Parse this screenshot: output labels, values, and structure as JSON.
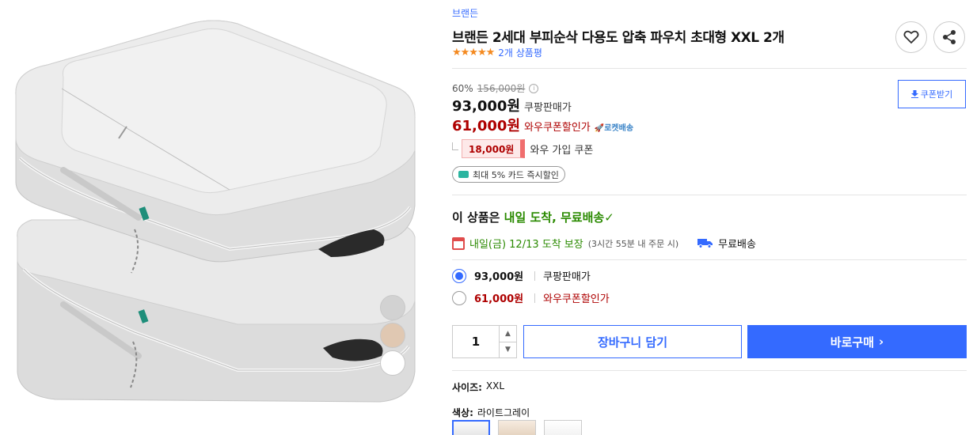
{
  "product": {
    "brand": "브랜든",
    "title": "브랜든 2세대 부피순삭 다용도 압축 파우치 초대형 XXL 2개",
    "stars": "★★★★★",
    "review_count": "2개 상품평"
  },
  "pricing": {
    "discount_rate": "60%",
    "original_price": "156,000원",
    "info_glyph": "i",
    "price": "93,000원",
    "price_label": "쿠팡판매가",
    "wow_price": "61,000원",
    "wow_label": "와우쿠폰할인가",
    "rocket_label": "🚀로켓배송",
    "coupon_button": "쿠폰받기",
    "coupon_amount": "18,000원",
    "coupon_text": "와우 가입 쿠폰",
    "card_discount": "최대 5% 카드 즉시할인"
  },
  "delivery": {
    "head_prefix": "이 상품은 ",
    "head_highlight": "내일 도착, 무료배송",
    "check": "✓",
    "date": "내일(금) 12/13 도착 보장",
    "cutoff": "(3시간 55분 내 주문 시)",
    "shipping": "무료배송"
  },
  "options": [
    {
      "price": "93,000원",
      "label": "쿠팡판매가",
      "selected": true
    },
    {
      "price": "61,000원",
      "label": "와우쿠폰할인가",
      "selected": false
    }
  ],
  "purchase": {
    "quantity": "1",
    "qty_up": "▲",
    "qty_down": "▼",
    "cart_button": "장바구니 담기",
    "buy_button": "바로구매",
    "buy_arrow": "›"
  },
  "specs": {
    "size_label": "사이즈:",
    "size_value": "XXL",
    "color_label": "색상:",
    "color_value": "라이트그레이"
  },
  "colors": {
    "accent": "#346aff",
    "wow_red": "#ae0000",
    "green": "#2a8a00",
    "star": "#f4891f"
  }
}
